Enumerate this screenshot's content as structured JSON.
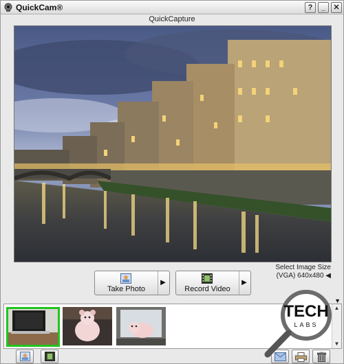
{
  "window": {
    "title": "QuickCam®",
    "minimize": "_",
    "maximize": "□",
    "close": "✕"
  },
  "subtitle": "QuickCapture",
  "image_size": {
    "label": "Select Image Size",
    "value": "(VGA) 640x480 ◀"
  },
  "actions": {
    "take_photo": {
      "label": "Take Photo",
      "arrow": "▶"
    },
    "record_video": {
      "label": "Record Video",
      "arrow": "▶"
    }
  },
  "watermark": {
    "top": "TECH",
    "bottom": "LABS"
  },
  "gallery": {
    "scroll_up": "▲",
    "scroll_down": "▼",
    "thumbs": [
      {
        "name": "thumbnail-laptop",
        "selected": true
      },
      {
        "name": "thumbnail-teddy-bear",
        "selected": false
      },
      {
        "name": "thumbnail-teddy-bear-2",
        "selected": false
      }
    ]
  },
  "colors": {
    "selection": "#21c41e",
    "titlebar": "#e0e0e0"
  }
}
